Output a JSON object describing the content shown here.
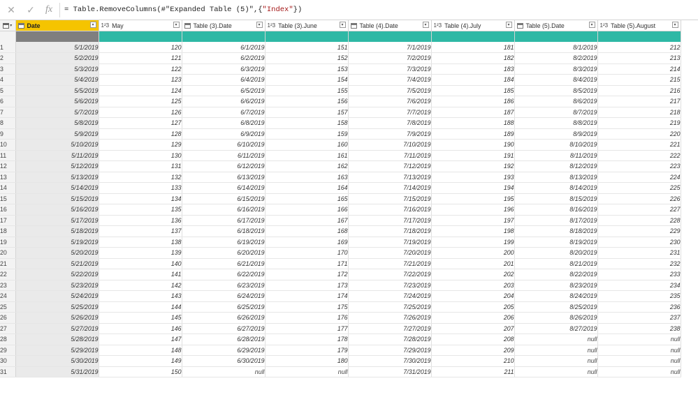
{
  "formula_bar": {
    "cancel_glyph": "✕",
    "commit_glyph": "✓",
    "fx_label": "fx",
    "formula_prefix": "= Table.RemoveColumns(#\"Expanded Table (5)\",{",
    "formula_string": "\"Index\"",
    "formula_suffix": "})"
  },
  "columns": [
    {
      "name": "Date",
      "type": "date",
      "selected": true
    },
    {
      "name": "May",
      "type": "number"
    },
    {
      "name": "Table (3).Date",
      "type": "date"
    },
    {
      "name": "Table (3).June",
      "type": "number"
    },
    {
      "name": "Table (4).Date",
      "type": "date"
    },
    {
      "name": "Table (4).July",
      "type": "number"
    },
    {
      "name": "Table (5).Date",
      "type": "date"
    },
    {
      "name": "Table (5).August",
      "type": "number"
    }
  ],
  "type_labels": {
    "number": "1²3"
  },
  "rows": [
    [
      "1",
      "5/1/2019",
      "120",
      "6/1/2019",
      "151",
      "7/1/2019",
      "181",
      "8/1/2019",
      "212"
    ],
    [
      "2",
      "5/2/2019",
      "121",
      "6/2/2019",
      "152",
      "7/2/2019",
      "182",
      "8/2/2019",
      "213"
    ],
    [
      "3",
      "5/3/2019",
      "122",
      "6/3/2019",
      "153",
      "7/3/2019",
      "183",
      "8/3/2019",
      "214"
    ],
    [
      "4",
      "5/4/2019",
      "123",
      "6/4/2019",
      "154",
      "7/4/2019",
      "184",
      "8/4/2019",
      "215"
    ],
    [
      "5",
      "5/5/2019",
      "124",
      "6/5/2019",
      "155",
      "7/5/2019",
      "185",
      "8/5/2019",
      "216"
    ],
    [
      "6",
      "5/6/2019",
      "125",
      "6/6/2019",
      "156",
      "7/6/2019",
      "186",
      "8/6/2019",
      "217"
    ],
    [
      "7",
      "5/7/2019",
      "126",
      "6/7/2019",
      "157",
      "7/7/2019",
      "187",
      "8/7/2019",
      "218"
    ],
    [
      "8",
      "5/8/2019",
      "127",
      "6/8/2019",
      "158",
      "7/8/2019",
      "188",
      "8/8/2019",
      "219"
    ],
    [
      "9",
      "5/9/2019",
      "128",
      "6/9/2019",
      "159",
      "7/9/2019",
      "189",
      "8/9/2019",
      "220"
    ],
    [
      "10",
      "5/10/2019",
      "129",
      "6/10/2019",
      "160",
      "7/10/2019",
      "190",
      "8/10/2019",
      "221"
    ],
    [
      "11",
      "5/11/2019",
      "130",
      "6/11/2019",
      "161",
      "7/11/2019",
      "191",
      "8/11/2019",
      "222"
    ],
    [
      "12",
      "5/12/2019",
      "131",
      "6/12/2019",
      "162",
      "7/12/2019",
      "192",
      "8/12/2019",
      "223"
    ],
    [
      "13",
      "5/13/2019",
      "132",
      "6/13/2019",
      "163",
      "7/13/2019",
      "193",
      "8/13/2019",
      "224"
    ],
    [
      "14",
      "5/14/2019",
      "133",
      "6/14/2019",
      "164",
      "7/14/2019",
      "194",
      "8/14/2019",
      "225"
    ],
    [
      "15",
      "5/15/2019",
      "134",
      "6/15/2019",
      "165",
      "7/15/2019",
      "195",
      "8/15/2019",
      "226"
    ],
    [
      "16",
      "5/16/2019",
      "135",
      "6/16/2019",
      "166",
      "7/16/2019",
      "196",
      "8/16/2019",
      "227"
    ],
    [
      "17",
      "5/17/2019",
      "136",
      "6/17/2019",
      "167",
      "7/17/2019",
      "197",
      "8/17/2019",
      "228"
    ],
    [
      "18",
      "5/18/2019",
      "137",
      "6/18/2019",
      "168",
      "7/18/2019",
      "198",
      "8/18/2019",
      "229"
    ],
    [
      "19",
      "5/19/2019",
      "138",
      "6/19/2019",
      "169",
      "7/19/2019",
      "199",
      "8/19/2019",
      "230"
    ],
    [
      "20",
      "5/20/2019",
      "139",
      "6/20/2019",
      "170",
      "7/20/2019",
      "200",
      "8/20/2019",
      "231"
    ],
    [
      "21",
      "5/21/2019",
      "140",
      "6/21/2019",
      "171",
      "7/21/2019",
      "201",
      "8/21/2019",
      "232"
    ],
    [
      "22",
      "5/22/2019",
      "141",
      "6/22/2019",
      "172",
      "7/22/2019",
      "202",
      "8/22/2019",
      "233"
    ],
    [
      "23",
      "5/23/2019",
      "142",
      "6/23/2019",
      "173",
      "7/23/2019",
      "203",
      "8/23/2019",
      "234"
    ],
    [
      "24",
      "5/24/2019",
      "143",
      "6/24/2019",
      "174",
      "7/24/2019",
      "204",
      "8/24/2019",
      "235"
    ],
    [
      "25",
      "5/25/2019",
      "144",
      "6/25/2019",
      "175",
      "7/25/2019",
      "205",
      "8/25/2019",
      "236"
    ],
    [
      "26",
      "5/26/2019",
      "145",
      "6/26/2019",
      "176",
      "7/26/2019",
      "206",
      "8/26/2019",
      "237"
    ],
    [
      "27",
      "5/27/2019",
      "146",
      "6/27/2019",
      "177",
      "7/27/2019",
      "207",
      "8/27/2019",
      "238"
    ],
    [
      "28",
      "5/28/2019",
      "147",
      "6/28/2019",
      "178",
      "7/28/2019",
      "208",
      "null",
      "null"
    ],
    [
      "29",
      "5/29/2019",
      "148",
      "6/29/2019",
      "179",
      "7/29/2019",
      "209",
      "null",
      "null"
    ],
    [
      "30",
      "5/30/2019",
      "149",
      "6/30/2019",
      "180",
      "7/30/2019",
      "210",
      "null",
      "null"
    ],
    [
      "31",
      "5/31/2019",
      "150",
      "null",
      "null",
      "7/31/2019",
      "211",
      "null",
      "null"
    ]
  ],
  "colors": {
    "selected_header": "#f5c400",
    "quality_bar": "#2eb8a5"
  }
}
